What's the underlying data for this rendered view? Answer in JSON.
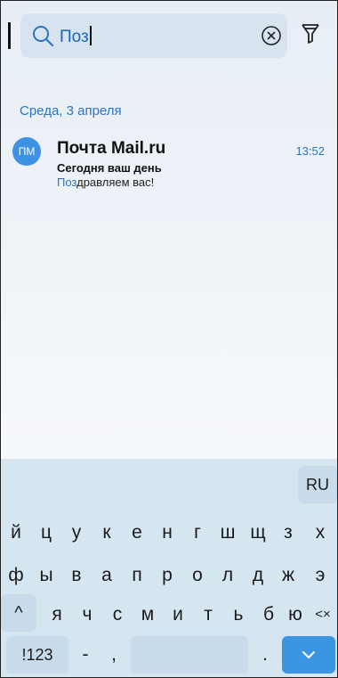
{
  "search": {
    "query": "Поз"
  },
  "icons": {
    "search": "search-icon",
    "clear": "clear-icon",
    "filter": "filter-icon",
    "shift": "shift-icon",
    "backspace": "backspace-icon",
    "done": "chevron-down-icon"
  },
  "list": {
    "date_header": "Среда, 3 апреля",
    "items": [
      {
        "avatar": "ПМ",
        "sender": "Почта Mail.ru",
        "time": "13:52",
        "subject": "Сегодня ваш день",
        "snippet_match": "Поз",
        "snippet_rest": "дравляем вас!"
      }
    ]
  },
  "keyboard": {
    "lang": "RU",
    "row1": [
      "й",
      "ц",
      "у",
      "к",
      "е",
      "н",
      "г",
      "ш",
      "щ",
      "з",
      "х"
    ],
    "row2": [
      "ф",
      "ы",
      "в",
      "а",
      "п",
      "р",
      "о",
      "л",
      "д",
      "ж",
      "э"
    ],
    "row3": [
      "^",
      "я",
      "ч",
      "с",
      "м",
      "и",
      "т",
      "ь",
      "б",
      "ю",
      "<×"
    ],
    "row4": [
      "!123",
      "-",
      ",",
      "",
      ".",
      ""
    ]
  },
  "colors": {
    "accent": "#2a74c2",
    "avatar": "#3e92e3",
    "keyboard_bg": "#d6e6f1",
    "done_key": "#3b95e3"
  }
}
